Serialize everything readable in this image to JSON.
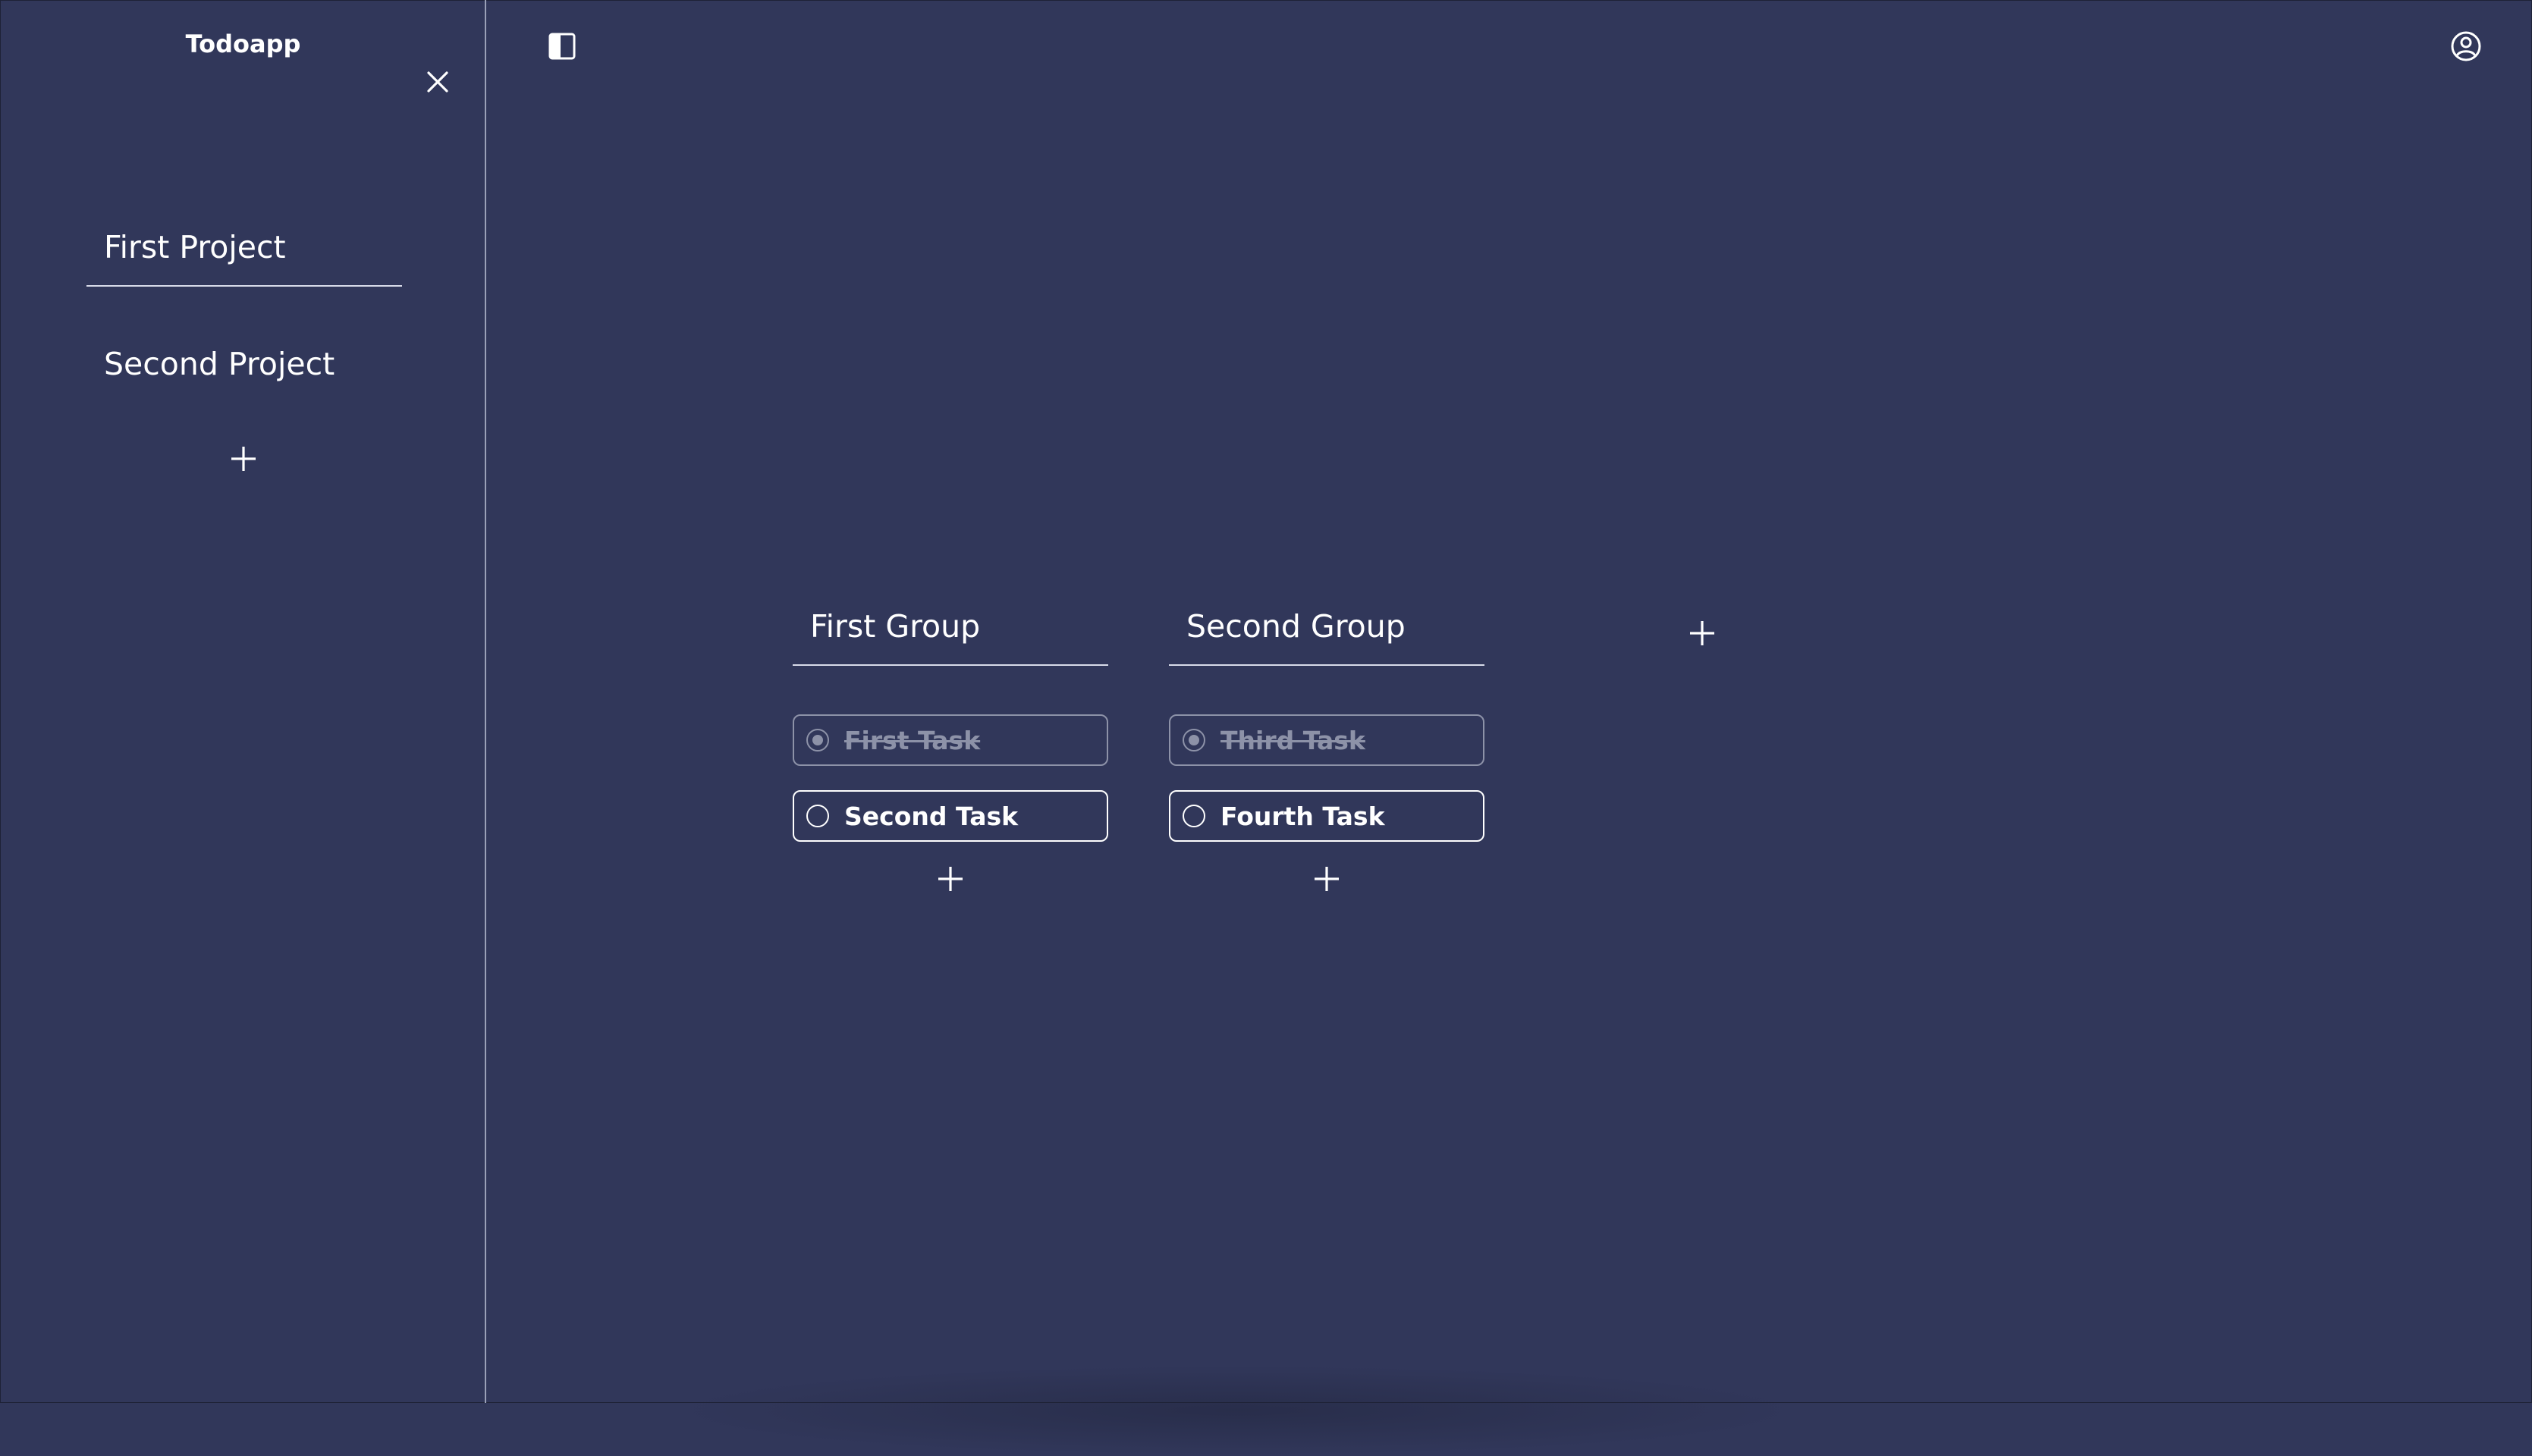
{
  "app": {
    "title": "Todoapp"
  },
  "colors": {
    "background": "#31375a",
    "text": "#ffffff",
    "muted": "#8d92a8",
    "divider": "#9aa0b8"
  },
  "sidebar": {
    "close_icon": "close-icon",
    "add_icon": "plus-icon",
    "projects": [
      {
        "label": "First Project",
        "active": true
      },
      {
        "label": "Second Project",
        "active": false
      }
    ]
  },
  "toolbar": {
    "sidebar_toggle_icon": "sidebar-toggle-icon",
    "account_icon": "user-circle-icon"
  },
  "board": {
    "add_group_icon": "plus-icon",
    "groups": [
      {
        "title": "First Group",
        "tasks": [
          {
            "label": "First Task",
            "done": true
          },
          {
            "label": "Second Task",
            "done": false
          }
        ]
      },
      {
        "title": "Second Group",
        "tasks": [
          {
            "label": "Third Task",
            "done": true
          },
          {
            "label": "Fourth Task",
            "done": false
          }
        ]
      }
    ]
  }
}
